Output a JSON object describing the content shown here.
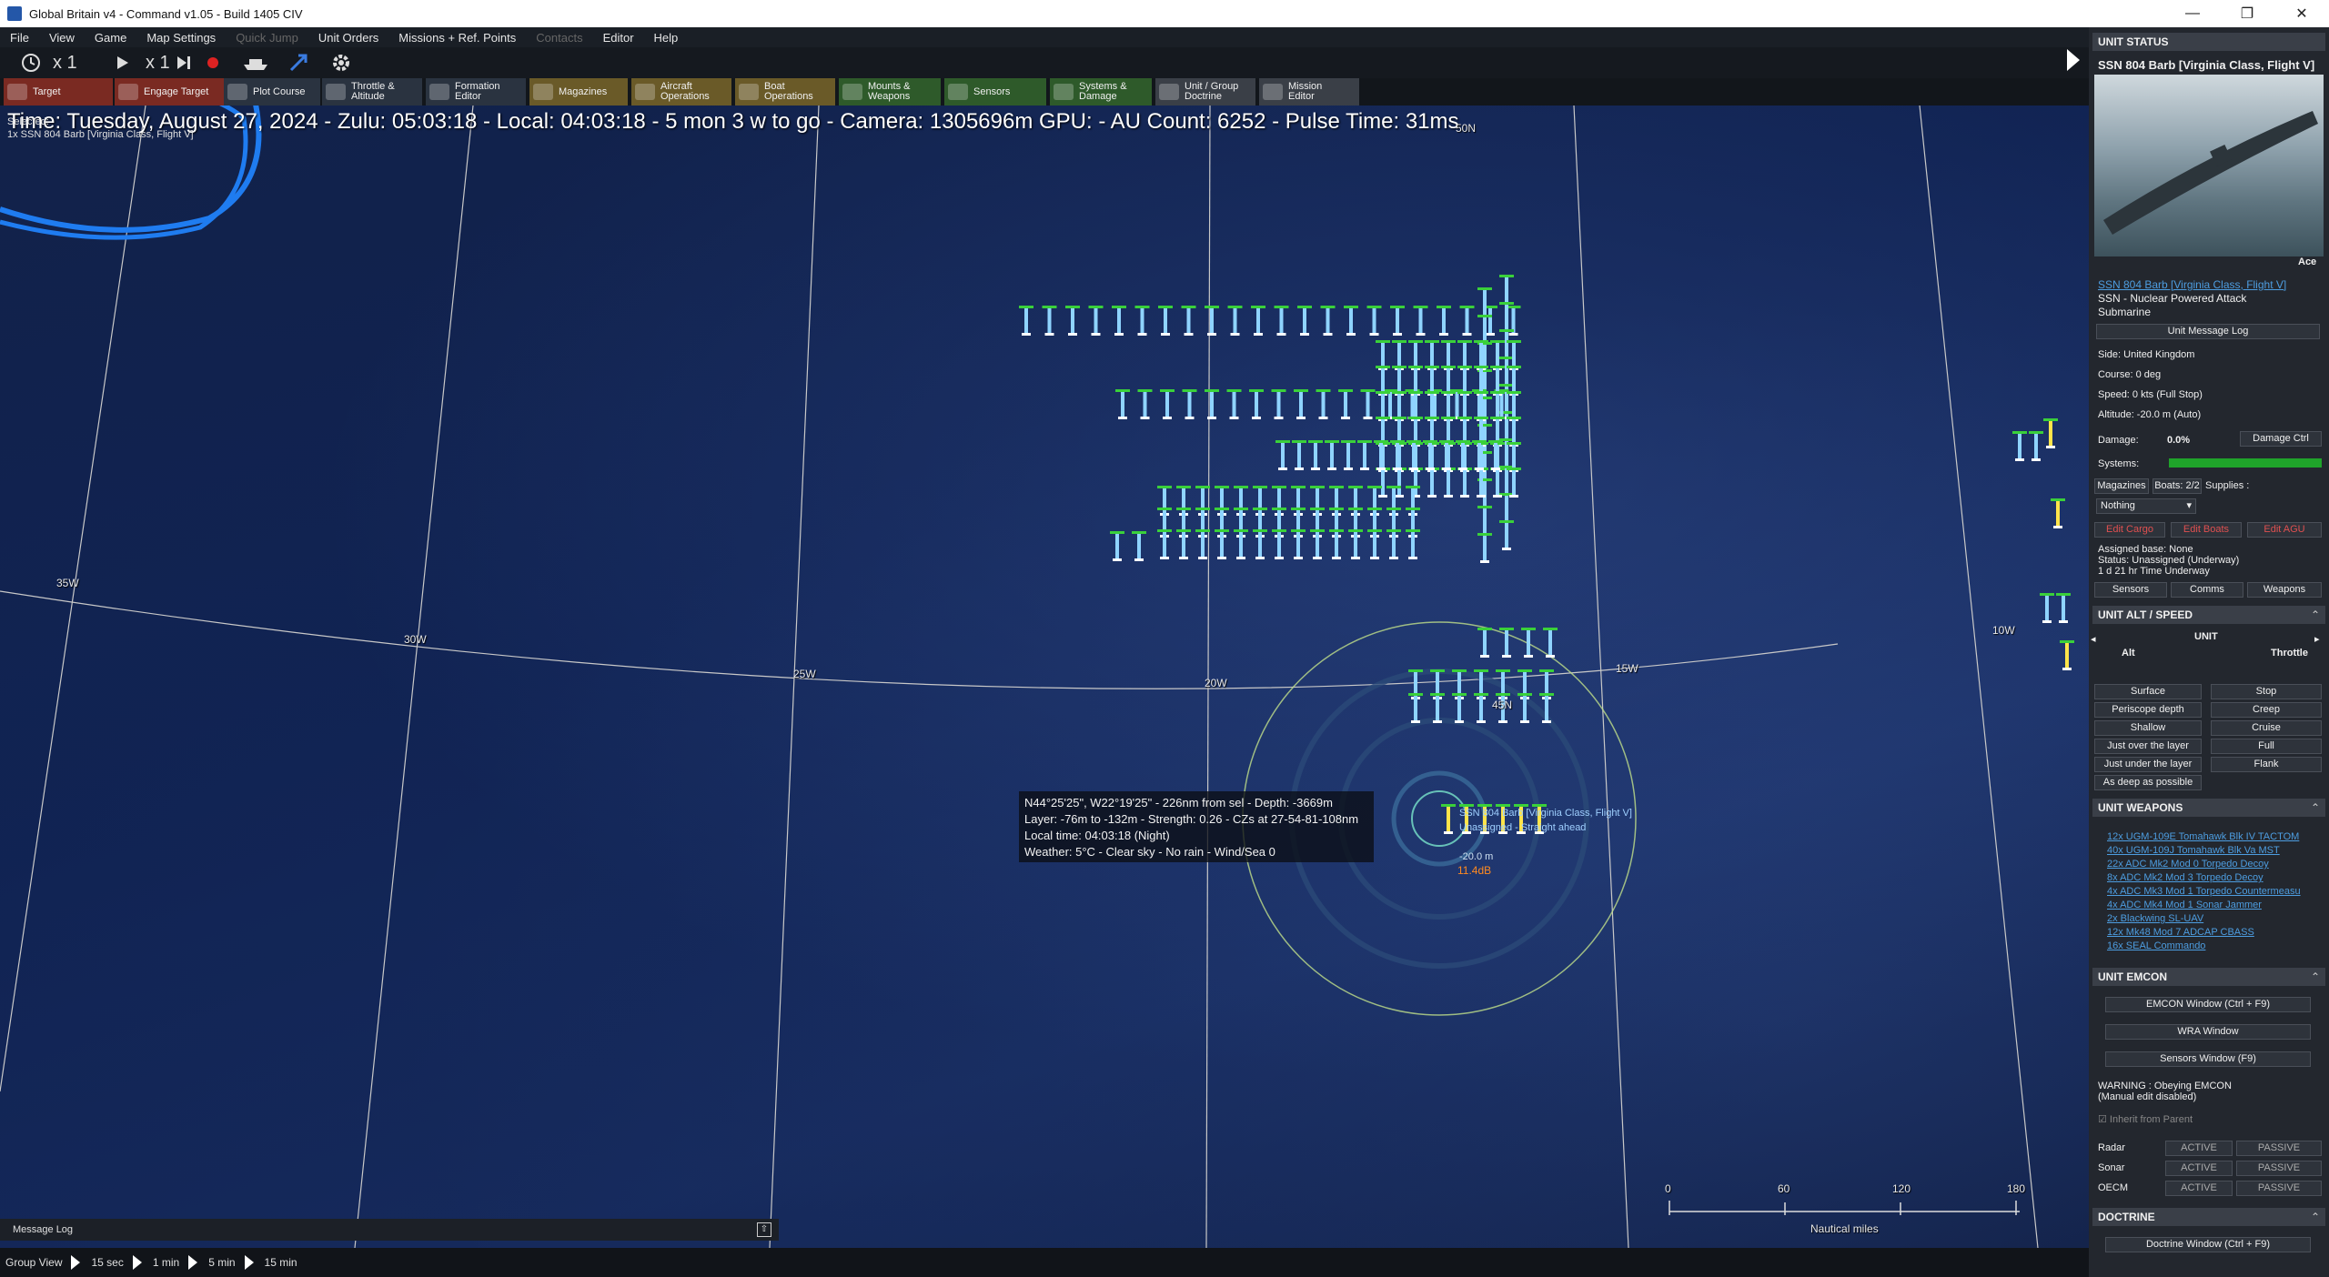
{
  "window": {
    "title": "Global Britain v4 - Command v1.05 - Build 1405 CIV"
  },
  "menu": [
    "File",
    "View",
    "Game",
    "Map Settings",
    "Quick Jump",
    "Unit Orders",
    "Missions + Ref. Points",
    "Contacts",
    "Editor",
    "Help"
  ],
  "menu_disabled": [
    "Quick Jump",
    "Contacts"
  ],
  "toolbar": {
    "speed1": "x 1",
    "speed2": "x 1"
  },
  "toolbar2": [
    {
      "label": "Target",
      "label2": ""
    },
    {
      "label": "Engage Target",
      "label2": ""
    },
    {
      "label": "Plot Course",
      "label2": ""
    },
    {
      "label": "Throttle &",
      "label2": "Altitude"
    },
    {
      "label": "Formation",
      "label2": "Editor"
    },
    {
      "label": "Magazines",
      "label2": ""
    },
    {
      "label": "Aircraft",
      "label2": "Operations"
    },
    {
      "label": "Boat",
      "label2": "Operations"
    },
    {
      "label": "Mounts &",
      "label2": "Weapons"
    },
    {
      "label": "Sensors",
      "label2": ""
    },
    {
      "label": "Systems &",
      "label2": "Damage"
    },
    {
      "label": "Unit / Group",
      "label2": "Doctrine"
    },
    {
      "label": "Mission",
      "label2": "Editor"
    }
  ],
  "hud": {
    "line": "Time: Tuesday, August 27, 2024 - Zulu: 05:03:18 - Local: 04:03:18 - 5 mon 3 w to go -  Camera: 1305696m  GPU:  - AU Count: 6252 - Pulse Time: 31ms",
    "selected_label": "Selected:",
    "selected_unit": "1x SSN 804 Barb [Virginia Class, Flight V]"
  },
  "map_labels": {
    "lat_50n": "50N",
    "lon_35w": "35W",
    "lon_30w": "30W",
    "lon_25w": "25W",
    "lon_20w": "20W",
    "lon_15w": "15W",
    "lon_10w": "10W",
    "lat_45n": "45N"
  },
  "tooltip": {
    "line1": "N44°25'25\", W22°19'25\" - 226nm from sel - Depth: -3669m",
    "line2": "Layer: -76m to -132m - Strength: 0.26 - CZs at 27-54-81-108nm",
    "line3": "Local time: 04:03:18 (Night)",
    "line4": "Weather: 5°C - Clear sky - No rain - Wind/Sea 0"
  },
  "unit_marker": {
    "name": "SSN 804 Barb [Virginia Class, Flight V]",
    "status": "Unassigned - Straight ahead",
    "depth": "-20.0 m",
    "noise": "11.4dB"
  },
  "scale": {
    "ticks": [
      "0",
      "60",
      "120",
      "180"
    ],
    "unit": "Nautical miles"
  },
  "message_log": {
    "label": "Message Log"
  },
  "statusbar": {
    "group_view": "Group View",
    "steps": [
      "15 sec",
      "1 min",
      "5 min",
      "15 min"
    ]
  },
  "unit_status": {
    "header": "UNIT STATUS",
    "title": "SSN 804 Barb [Virginia Class, Flight V]",
    "proficiency": "Ace",
    "link": "SSN 804 Barb [Virginia Class, Flight V]",
    "type": "SSN - Nuclear Powered Attack",
    "type2": "Submarine",
    "msg_log_button": "Unit Message Log",
    "side": "Side: United Kingdom",
    "course": "Course: 0 deg",
    "speed": "Speed: 0 kts (Full Stop)",
    "altitude": "Altitude: -20.0 m (Auto)",
    "damage_label": "Damage:",
    "damage_value": "0.0%",
    "damage_ctrl": "Damage Ctrl",
    "systems_label": "Systems:",
    "magazines": "Magazines",
    "boats": "Boats: 2/2",
    "supplies": "Supplies :",
    "supplies_select": "Nothing",
    "edit_cargo": "Edit Cargo",
    "edit_boats": "Edit Boats",
    "edit_agu": "Edit AGU",
    "assigned_base": "Assigned base: None",
    "status": "Status: Unassigned (Underway)",
    "time_underway": "1 d 21 hr Time Underway",
    "sensors_btn": "Sensors",
    "comms_btn": "Comms",
    "weapons_btn": "Weapons"
  },
  "unit_alt": {
    "header": "UNIT ALT / SPEED",
    "unit_label": "UNIT",
    "alt_label": "Alt",
    "throttle_label": "Throttle",
    "alt_buttons": [
      "Surface",
      "Periscope depth",
      "Shallow",
      "Just over the layer",
      "Just under the layer",
      "As deep as possible"
    ],
    "speed_buttons": [
      "Stop",
      "Creep",
      "Cruise",
      "Full",
      "Flank"
    ]
  },
  "unit_weapons": {
    "header": "UNIT WEAPONS",
    "items": [
      "12x UGM-109E Tomahawk Blk IV TACTOM",
      "40x UGM-109J Tomahawk Blk Va MST",
      "22x ADC Mk2 Mod 0 Torpedo Decoy",
      "8x ADC Mk2 Mod 3 Torpedo Decoy",
      "4x ADC Mk3 Mod 1 Torpedo Countermeasu",
      "4x ADC Mk4 Mod 1 Sonar Jammer",
      "2x Blackwing SL-UAV",
      "12x Mk48 Mod 7 ADCAP CBASS",
      "16x SEAL Commando"
    ]
  },
  "unit_emcon": {
    "header": "UNIT EMCON",
    "emcon_window": "EMCON Window (Ctrl + F9)",
    "wra_window": "WRA Window",
    "sensors_window": "Sensors Window (F9)",
    "warning1": "WARNING : Obeying EMCON",
    "warning2": "(Manual edit disabled)",
    "inherit": "Inherit from Parent",
    "rows": [
      {
        "label": "Radar",
        "active": "ACTIVE",
        "passive": "PASSIVE"
      },
      {
        "label": "Sonar",
        "active": "ACTIVE",
        "passive": "PASSIVE"
      },
      {
        "label": "OECM",
        "active": "ACTIVE",
        "passive": "PASSIVE"
      }
    ]
  },
  "doctrine": {
    "header": "DOCTRINE",
    "window": "Doctrine Window (Ctrl + F9)"
  }
}
